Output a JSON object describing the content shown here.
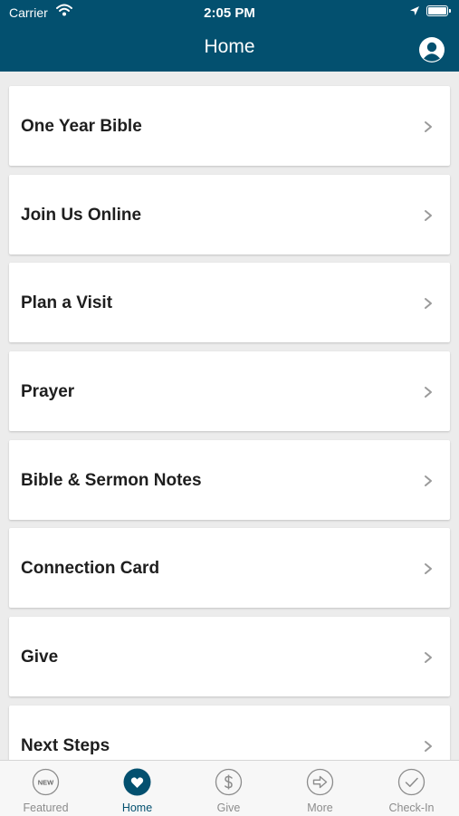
{
  "status_bar": {
    "carrier": "Carrier",
    "time": "2:05 PM"
  },
  "header": {
    "title": "Home"
  },
  "items": [
    {
      "label": "One Year Bible"
    },
    {
      "label": "Join Us Online"
    },
    {
      "label": "Plan a Visit"
    },
    {
      "label": "Prayer"
    },
    {
      "label": "Bible & Sermon Notes"
    },
    {
      "label": "Connection Card"
    },
    {
      "label": "Give"
    },
    {
      "label": "Next Steps"
    }
  ],
  "tabs": [
    {
      "label": "Featured",
      "icon": "new-badge-icon",
      "badge": "NEW"
    },
    {
      "label": "Home",
      "icon": "heart-icon",
      "active": true
    },
    {
      "label": "Give",
      "icon": "dollar-icon"
    },
    {
      "label": "More",
      "icon": "arrow-circle-icon"
    },
    {
      "label": "Check-In",
      "icon": "checkmark-icon"
    }
  ],
  "colors": {
    "brand": "#03506f",
    "background": "#ececec",
    "inactive_tab": "#8c8c8c"
  }
}
